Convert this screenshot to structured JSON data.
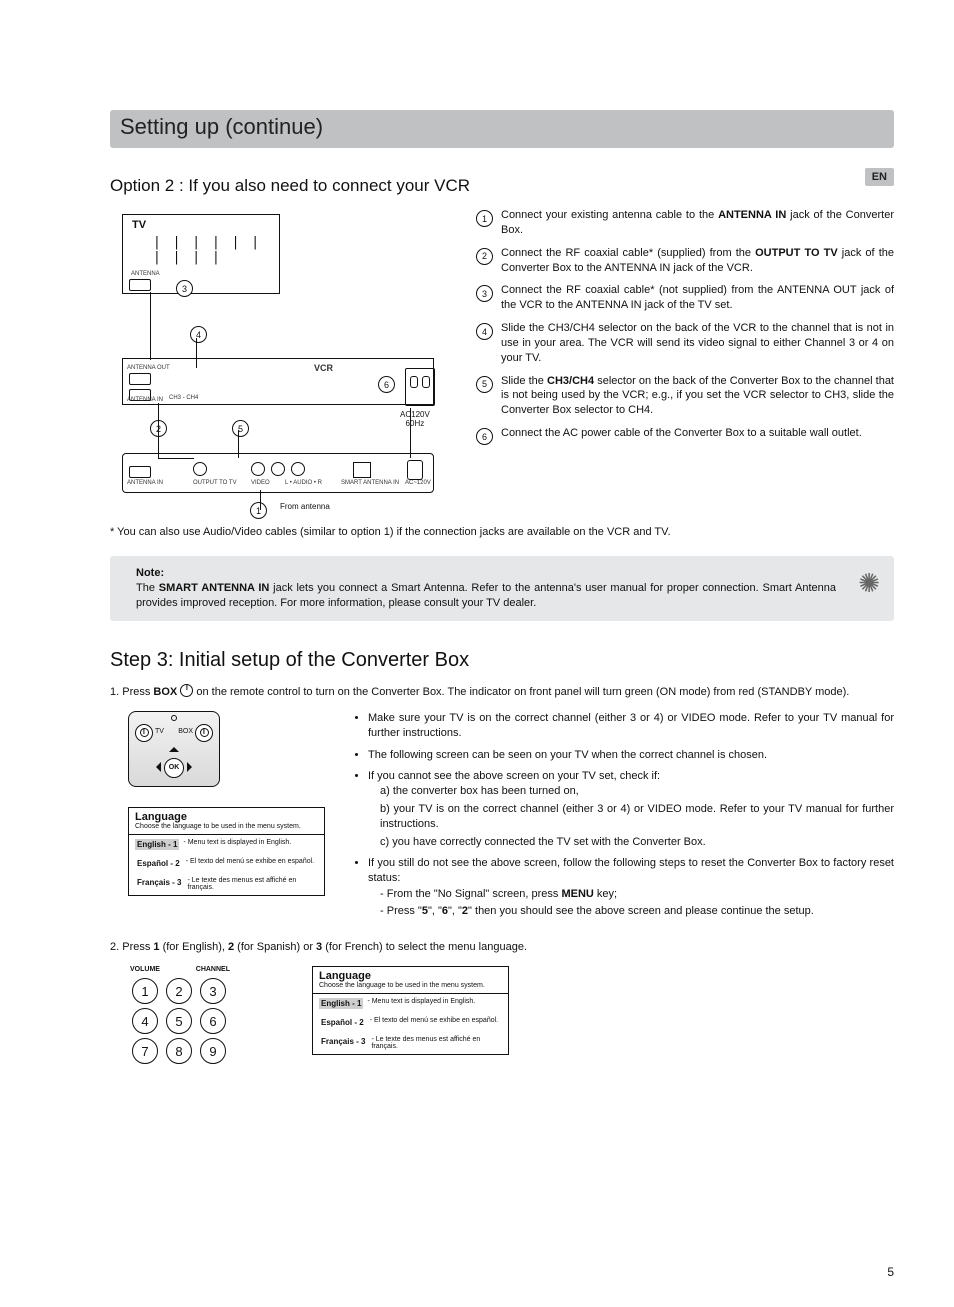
{
  "title": "Setting up (continue)",
  "lang_tab": "EN",
  "option2_heading": "Option 2 :  If you also need to connect your VCR",
  "diagram": {
    "tv": "TV",
    "vcr": "VCR",
    "ant": "ANTENNA",
    "ant_in": "ANTENNA IN",
    "ant_out": "ANTENNA OUT",
    "ch34": "CH3 - CH4",
    "ac": "AC120V\n60Hz",
    "from_antenna": "From antenna",
    "out_tv": "OUTPUT TO TV",
    "video": "VIDEO",
    "audio": "L • AUDIO • R",
    "smart": "SMART ANTENNA IN",
    "acport": "AC~120V"
  },
  "steps": [
    {
      "n": "1",
      "text": "Connect your existing antenna cable to the ",
      "bold": "ANTENNA IN",
      "tail": " jack of the Converter Box."
    },
    {
      "n": "2",
      "text": "Connect the RF coaxial cable* (supplied) from the ",
      "bold": "OUTPUT TO TV",
      "tail": " jack of the Converter Box to the ANTENNA IN jack of the VCR."
    },
    {
      "n": "3",
      "text": "Connect the RF coaxial cable* (not supplied) from the ANTENNA OUT jack of the VCR to the ANTENNA IN jack of the TV set."
    },
    {
      "n": "4",
      "text": "Slide the CH3/CH4 selector on the back of the VCR to the channel that is not in use in your area. The VCR will send its video signal to either Channel 3 or 4 on your TV."
    },
    {
      "n": "5",
      "text": "Slide the ",
      "bold": "CH3/CH4",
      "tail": " selector on the back of the Converter Box to the channel that is not being used by the VCR; e.g., if you set the VCR selector to CH3, slide the Converter Box selector to CH4."
    },
    {
      "n": "6",
      "text": "Connect the AC power cable of the Converter Box to a suitable wall outlet."
    }
  ],
  "footnote": "*  You can also use Audio/Video cables (similar to option 1) if the connection jacks are available on the VCR and TV.",
  "note_lbl": "Note:",
  "note_text_a": "The ",
  "note_bold": "SMART ANTENNA IN",
  "note_text_b": " jack lets you connect a Smart Antenna. Refer to the antenna's user manual for proper connection. Smart Antenna provides improved reception. For more information, please consult your TV dealer.",
  "step3_heading": "Step 3: Initial setup of the Converter Box",
  "s3_1a": "1.  Press ",
  "s3_1b": "BOX",
  "s3_1c": " on the remote control to turn on the  Converter Box. The indicator on front panel will turn green (ON mode) from red (STANDBY mode).",
  "remote": {
    "tv": "TV",
    "box": "BOX",
    "ok": "OK"
  },
  "lang_menu": {
    "title": "Language",
    "sub": "Choose the language to be used in the menu system.",
    "rows": [
      {
        "tag": "English - 1",
        "desc": "- Menu text is displayed in English.",
        "hl": true
      },
      {
        "tag": "Español - 2",
        "desc": "- El texto del menú se exhibe en español.",
        "hl": false
      },
      {
        "tag": "Français - 3",
        "desc": "- Le texte des menus est affiché en français.",
        "hl": false
      }
    ]
  },
  "bullets": {
    "b1": "Make sure your TV is on the correct channel (either 3 or 4) or VIDEO mode. Refer to your TV manual for further instructions.",
    "b2": "The following screen can be seen on your TV when the correct channel is chosen.",
    "b3": "If you cannot see the above screen on your TV set, check if:",
    "b3a": "a)  the converter box has been turned on,",
    "b3b": "b)  your TV is on the correct channel (either 3 or 4) or VIDEO mode. Refer to your TV manual for further instructions.",
    "b3c": "c)  you have correctly connected the TV set with the Converter Box.",
    "b4": "If you still do not see the above screen, follow the following steps to reset the Converter Box to factory reset status:",
    "b4a": "From the \"No Signal\" screen, press ",
    "b4a_bold": "MENU",
    "b4a_tail": " key;",
    "b4b_a": "Press \"",
    "b4b_5": "5",
    "b4b_b": "\", \"",
    "b4b_6": "6",
    "b4b_c": "\", \"",
    "b4b_2": "2",
    "b4b_d": "\" then you should see the above screen and please continue the setup."
  },
  "s3_2a": "2.  Press ",
  "s3_2_1": "1",
  "s3_2b": " (for English), ",
  "s3_2_2": "2",
  "s3_2c": " (for Spanish) or ",
  "s3_2_3": "3",
  "s3_2d": " (for French) to select the menu language.",
  "remote2": {
    "vol": "VOLUME",
    "ch": "CHANNEL",
    "n": [
      "1",
      "2",
      "3",
      "4",
      "5",
      "6",
      "7",
      "8",
      "9"
    ]
  },
  "page_number": "5"
}
